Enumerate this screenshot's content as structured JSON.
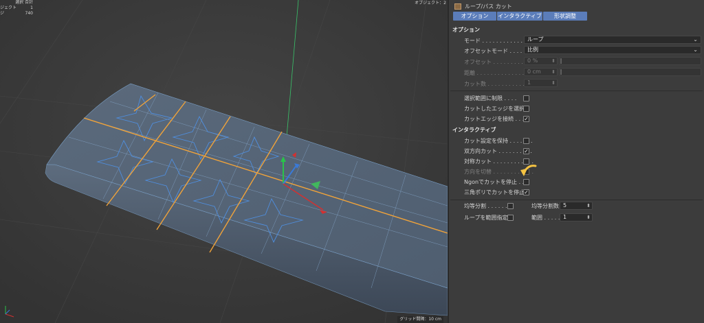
{
  "viewport": {
    "stats": [
      {
        "label": "",
        "value": "選択 合計"
      },
      {
        "label": "ジェクト",
        "value": "1"
      },
      {
        "label": "ジ",
        "value": "740"
      }
    ],
    "objects_label": "オブジェクト：2",
    "grid_label": "グリッド間隔：10 cm"
  },
  "panel": {
    "title": "ループ/パス カット",
    "tabs": [
      "オプション",
      "インタラクティブ",
      "形状調整"
    ],
    "options": {
      "header": "オプション",
      "mode": {
        "label": "モード . . . . . . . . . . . . . . . . . . . .",
        "value": "ループ"
      },
      "offset_mode": {
        "label": "オフセットモード . . . . . .",
        "value": "比例"
      },
      "offset": {
        "label": "オフセット . . . . . . . . . . . . . . .",
        "value": "0 %"
      },
      "distance": {
        "label": "距離 . . . . . . . . . . . . . . . . . . . .",
        "value": "0 cm"
      },
      "cuts": {
        "label": "カット数 . . . . . . . . . . . . . . .",
        "value": "1"
      },
      "restrict": {
        "label": "選択範囲に制限 . . . .",
        "checked": false
      },
      "select_cut": {
        "label": "カットしたエッジを選択",
        "checked": false
      },
      "connect_cut": {
        "label": "カットエッジを接続 . . . .",
        "checked": true
      }
    },
    "interactive": {
      "header": "インタラクティブ",
      "keep_settings": {
        "label": "カット設定を保持 . . . . . . .",
        "checked": false
      },
      "bidirectional": {
        "label": "双方向カット . . . . . . . . . .",
        "checked": true
      },
      "symmetric": {
        "label": "対称カット . . . . . . . . . . . .",
        "checked": false
      },
      "toggle_dir": {
        "label": "方向を切替 . . . . . . . . . . . .",
        "checked": false
      },
      "stop_ngon": {
        "label": "Ngonでカットを停止 . .",
        "checked": false
      },
      "stop_tri": {
        "label": "三角ポリでカットを停止",
        "checked": true
      }
    },
    "bottom": {
      "even_split": {
        "label": "均等分割 . . . . . . . .",
        "checked": false
      },
      "even_count": {
        "label": "均等分割数",
        "value": "5"
      },
      "loop_range": {
        "label": "ループを範囲指定",
        "checked": false
      },
      "range": {
        "label": "範囲 . . . . . . . . . .",
        "value": "1"
      }
    }
  },
  "colors": {
    "accent": "#5b7dba",
    "cut_line": "#f0a33a",
    "annotation_arrow": "#f5c342"
  }
}
